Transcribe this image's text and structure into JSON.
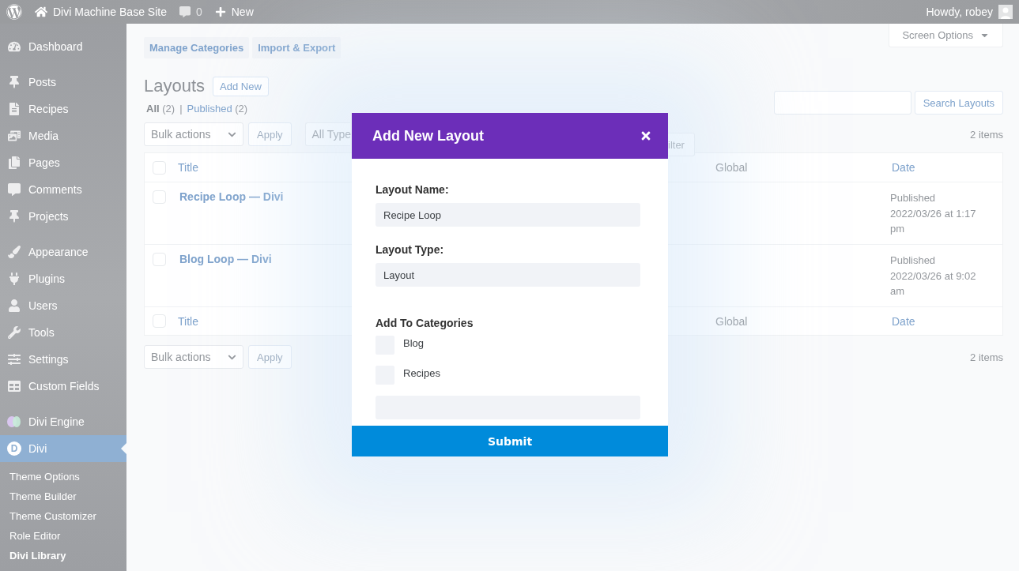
{
  "admin_bar": {
    "site_name": "Divi Machine Base Site",
    "comments_count": "0",
    "new_label": "New",
    "greeting": "Howdy, robey"
  },
  "sidebar": {
    "groups": [
      [
        {
          "label": "Dashboard",
          "selected": false
        }
      ],
      [
        {
          "label": "Posts",
          "selected": false
        },
        {
          "label": "Recipes",
          "selected": false
        },
        {
          "label": "Media",
          "selected": false
        },
        {
          "label": "Pages",
          "selected": false
        },
        {
          "label": "Comments",
          "selected": false
        },
        {
          "label": "Projects",
          "selected": false
        }
      ],
      [
        {
          "label": "Appearance",
          "selected": false
        },
        {
          "label": "Plugins",
          "selected": false
        },
        {
          "label": "Users",
          "selected": false
        },
        {
          "label": "Tools",
          "selected": false
        },
        {
          "label": "Settings",
          "selected": false
        },
        {
          "label": "Custom Fields",
          "selected": false
        }
      ],
      [
        {
          "label": "Divi Engine",
          "selected": false
        },
        {
          "label": "Divi",
          "selected": true,
          "logo_letter": "D"
        }
      ]
    ],
    "submenu": [
      {
        "label": "Theme Options",
        "selected": false
      },
      {
        "label": "Theme Builder",
        "selected": false
      },
      {
        "label": "Theme Customizer",
        "selected": false
      },
      {
        "label": "Role Editor",
        "selected": false
      },
      {
        "label": "Divi Library",
        "selected": true
      }
    ]
  },
  "screen_options": "Screen Options",
  "page_tabs": [
    "Manage Categories",
    "Import & Export"
  ],
  "heading": {
    "title": "Layouts",
    "add_new": "Add New"
  },
  "views_separator": "|",
  "views": [
    {
      "label": "All",
      "count": "(2)",
      "selected": true
    },
    {
      "label": "Published",
      "count": "(2)",
      "selected": false
    }
  ],
  "search": {
    "button": "Search Layouts"
  },
  "tablenav_top": {
    "bulk": "Bulk actions",
    "apply": "Apply",
    "type_filter": "All Type",
    "filter_button": "ilter",
    "count": "2 items"
  },
  "table": {
    "columns": [
      "Title",
      "Global",
      "Date"
    ],
    "rows": [
      {
        "title": "Recipe Loop — Divi",
        "date": "Published 2022/03/26 at 1:17 pm",
        "checked": false
      },
      {
        "title": "Blog Loop — Divi",
        "date": "Published 2022/03/26 at 9:02 am",
        "checked": false
      }
    ],
    "footer": [
      "Title",
      "Global",
      "Date"
    ],
    "header_checked": false,
    "footer_checked": false
  },
  "tablenav_bottom": {
    "bulk": "Bulk actions",
    "apply": "Apply",
    "count": "2 items"
  },
  "modal": {
    "title": "Add New Layout",
    "fields": [
      {
        "label": "Layout Name:",
        "value": "Recipe Loop"
      },
      {
        "label": "Layout Type:",
        "value": "Layout"
      }
    ],
    "categories_label": "Add To Categories",
    "categories": [
      {
        "label": "Blog",
        "checked": false
      },
      {
        "label": "Recipes",
        "checked": false
      }
    ],
    "submit": "Submit"
  }
}
